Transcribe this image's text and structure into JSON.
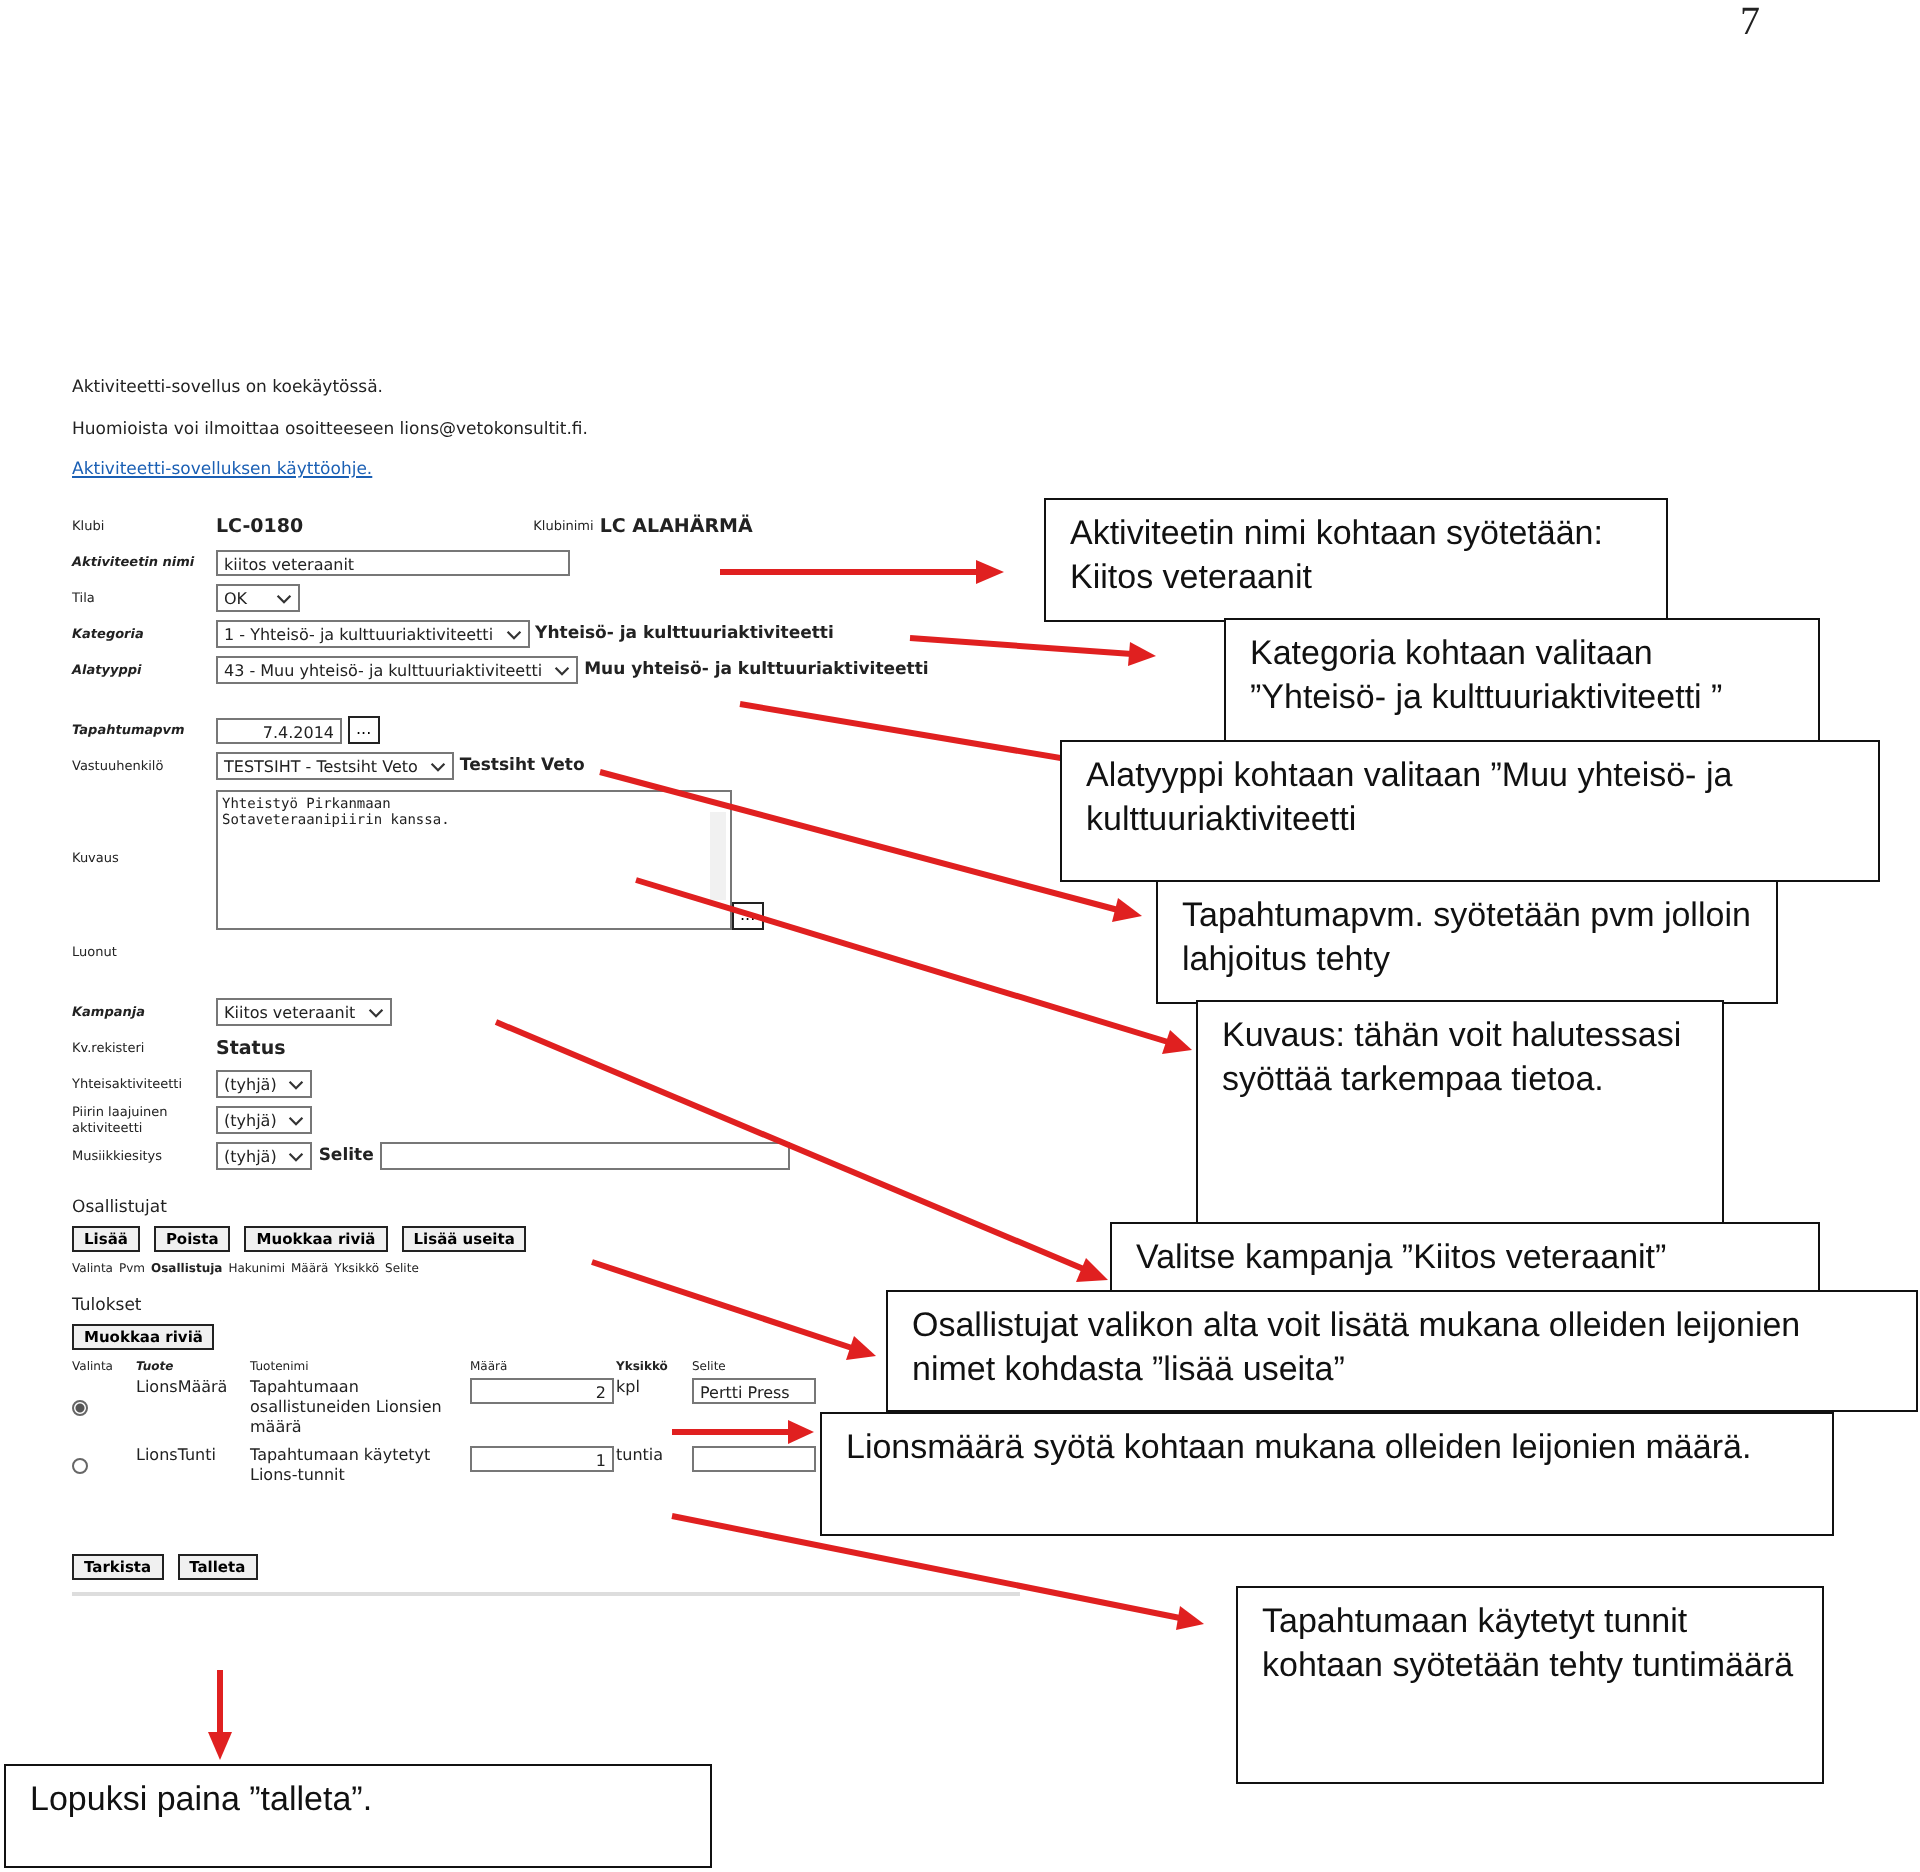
{
  "page_number": "7",
  "intro": [
    "Aktiviteetti-sovellus on koekäytössä.",
    "Huomioista voi ilmoittaa osoitteeseen lions@vetokonsultit.fi."
  ],
  "help_link": "Aktiviteetti-sovelluksen käyttöohje.",
  "form_sections": [
    [
      {
        "label": "Klubi",
        "required": false,
        "kind": "value",
        "value": "LC-0180",
        "extra_label": "Klubinimi",
        "extra_value": "LC ALAHÄRMÄ"
      },
      {
        "label": "Aktiviteetin nimi",
        "required": true,
        "kind": "text",
        "value": "kiitos veteraanit"
      },
      {
        "label": "Tila",
        "required": false,
        "kind": "select",
        "value": "OK"
      },
      {
        "label": "Kategoria",
        "required": true,
        "kind": "select",
        "value": "1 - Yhteisö- ja kulttuuriaktiviteetti",
        "note": "Yhteisö- ja kulttuuriaktiviteetti"
      },
      {
        "label": "Alatyyppi",
        "required": true,
        "kind": "select",
        "value": "43 - Muu yhteisö- ja kulttuuriaktiviteetti",
        "note": "Muu yhteisö- ja kulttuuriaktiviteetti"
      }
    ],
    [
      {
        "label": "Tapahtumapvm",
        "required": true,
        "kind": "date",
        "value": "7.4.2014",
        "button": "..."
      },
      {
        "label": "Vastuuhenkilö",
        "required": false,
        "kind": "select",
        "value": "TESTSIHT - Testsiht Veto",
        "note": "Testsiht Veto"
      },
      {
        "label": "Kuvaus",
        "required": false,
        "kind": "textarea",
        "value": "Yhteistyö Pirkanmaan\nSotaveteraanipiirin kanssa.",
        "button": "..."
      },
      {
        "label": "Luonut",
        "required": false,
        "kind": "empty"
      }
    ],
    [
      {
        "label": "Kampanja",
        "required": true,
        "kind": "select",
        "value": "Kiitos veteraanit"
      },
      {
        "label": "Kv.rekisteri",
        "required": false,
        "kind": "value",
        "value": "Status"
      },
      {
        "label": "Yhteisaktiviteetti",
        "required": false,
        "kind": "select",
        "value": "(tyhjä)"
      },
      {
        "label": "Piirin laajuinen aktiviteetti",
        "required": false,
        "kind": "select",
        "value": "(tyhjä)"
      },
      {
        "label": "Musiikkiesitys",
        "required": false,
        "kind": "select",
        "value": "(tyhjä)",
        "extra_label": "Selite",
        "extra_input": true
      }
    ]
  ],
  "participants": {
    "title": "Osallistujat",
    "buttons": [
      "Lisää",
      "Poista",
      "Muokkaa riviä",
      "Lisää useita"
    ],
    "columns": [
      {
        "label": "Valinta",
        "sorted": false
      },
      {
        "label": "Pvm",
        "sorted": false
      },
      {
        "label": "Osallistuja",
        "sorted": true
      },
      {
        "label": "Hakunimi",
        "sorted": false
      },
      {
        "label": "Määrä",
        "sorted": false
      },
      {
        "label": "Yksikkö",
        "sorted": false
      },
      {
        "label": "Selite",
        "sorted": false
      }
    ]
  },
  "results": {
    "title": "Tulokset",
    "buttons": [
      "Muokkaa riviä"
    ],
    "columns": [
      {
        "label": "Valinta",
        "sorted": false
      },
      {
        "label": "Tuote",
        "sorted": true
      },
      {
        "label": "Tuotenimi",
        "sorted": false
      },
      {
        "label": "Määrä",
        "sorted": false
      },
      {
        "label": "Yksikkö",
        "sorted": true
      },
      {
        "label": "Selite",
        "sorted": false
      }
    ],
    "rows": [
      {
        "selected": true,
        "product": "LionsMäärä",
        "name": "Tapahtumaan osallistuneiden Lionsien määrä",
        "amount": "2",
        "unit": "kpl",
        "note": "Pertti Press"
      },
      {
        "selected": false,
        "product": "LionsTunti",
        "name": "Tapahtumaan käytetyt Lions-tunnit",
        "amount": "1",
        "unit": "tuntia"
      }
    ]
  },
  "footer_buttons": [
    "Tarkista",
    "Talleta"
  ],
  "callouts": [
    "Aktiviteetin nimi kohtaan syötetään: Kiitos veteraanit",
    "Kategoria kohtaan valitaan ”Yhteisö- ja kulttuuriaktiviteetti ”",
    "Alatyyppi kohtaan valitaan ”Muu yhteisö- ja kulttuuriaktiviteetti",
    "Tapahtumapvm. syötetään pvm jolloin lahjoitus tehty",
    "Kuvaus: tähän voit halutessasi syöttää tarkempaa tietoa.",
    "Valitse kampanja ”Kiitos veteraanit”",
    "Osallistujat valikon alta voit lisätä mukana olleiden leijonien nimet kohdasta ”lisää useita”",
    "Lionsmäärä syötä kohtaan mukana olleiden leijonien määrä.",
    "Tapahtumaan käytetyt tunnit kohtaan syötetään tehty tuntimäärä",
    "Lopuksi paina ”talleta”."
  ]
}
